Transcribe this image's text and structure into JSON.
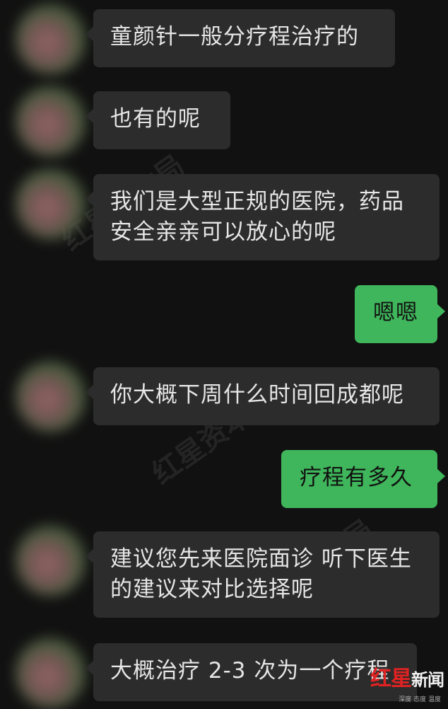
{
  "messages": [
    {
      "side": "in",
      "text": "童颜针一般分疗程治疗的"
    },
    {
      "side": "in",
      "text": "也有的呢"
    },
    {
      "side": "in",
      "text": "我们是大型正规的医院，药品安全亲亲可以放心的呢"
    },
    {
      "side": "out",
      "text": "嗯嗯"
    },
    {
      "side": "in",
      "text": "你大概下周什么时间回成都呢"
    },
    {
      "side": "out",
      "text": "疗程有多久"
    },
    {
      "side": "in",
      "text": "建议您先来医院面诊 听下医生的建议来对比选择呢"
    },
    {
      "side": "in",
      "text": "大概治疗 2-3 次为一个疗程"
    }
  ],
  "watermark": {
    "text": "红星资本局"
  },
  "branding": {
    "logo_main": "红星",
    "logo_suffix": "新闻",
    "logo_sub": "深度 态度 温度"
  },
  "theme": {
    "background": "#111111",
    "incoming_bubble": "#2c2c2c",
    "outgoing_bubble": "#3fb65b",
    "incoming_text": "#e6e6e6",
    "outgoing_text": "#111111",
    "logo_red": "#e02222"
  }
}
